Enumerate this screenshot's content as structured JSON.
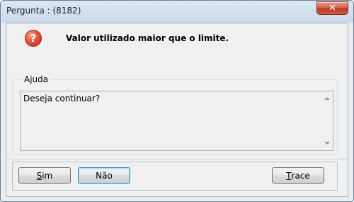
{
  "window": {
    "title": "Pergunta : (8182)",
    "close_glyph": "✕",
    "close_icon": "close-icon"
  },
  "dialog": {
    "icon": "question-icon",
    "icon_glyph": "?",
    "icon_color": "#d9472b",
    "message": "Valor utilizado maior que o limite."
  },
  "help": {
    "legend": "Ajuda",
    "text": "Deseja continuar?"
  },
  "buttons": {
    "yes": {
      "mnemonic": "S",
      "rest": "im"
    },
    "no": {
      "label": "Não"
    },
    "trace": {
      "mnemonic": "T",
      "rest": "race"
    }
  }
}
